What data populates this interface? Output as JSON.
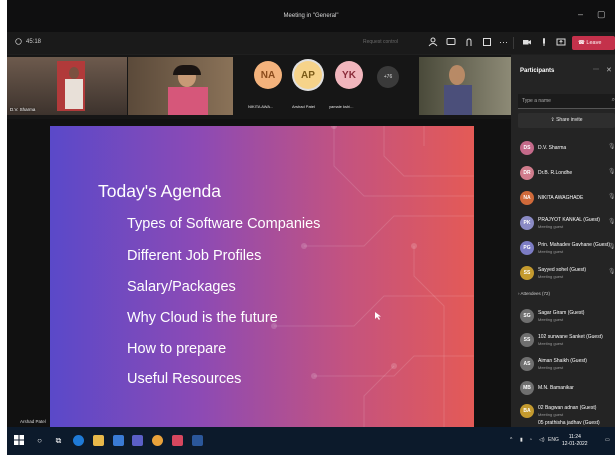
{
  "window": {
    "title": "Meeting in \"General\"",
    "minimize": "–",
    "maximize": "▢"
  },
  "toolbar": {
    "timer": "45:18",
    "request_control": "Request control",
    "leave_label": "Leave"
  },
  "videos": {
    "tile1_name": "D.V. Sharma",
    "avatars": [
      {
        "initials": "NA",
        "name": "NIKITA AWA...",
        "bg": "#f3b27c",
        "fg": "#8a4a1b"
      },
      {
        "initials": "AP",
        "name": "Arshad Patel",
        "bg": "#f6d38a",
        "fg": "#7a5a17"
      },
      {
        "initials": "YK",
        "name": "yamale kshi...",
        "bg": "#f1b6bd",
        "fg": "#8a2b3a"
      }
    ],
    "overflow": "+76"
  },
  "slide": {
    "title": "Today's Agenda",
    "items": [
      "Types of Software Companies",
      "Different Job Profiles",
      "Salary/Packages",
      "Why Cloud is the future",
      "How to prepare",
      "Useful Resources"
    ],
    "presenter": "Arshad Patel"
  },
  "participants": {
    "title": "Participants",
    "search_placeholder": "Type a name",
    "share_invite": "Share invite",
    "presenters": [
      {
        "initials": "DS",
        "name": "D.V. Sharma",
        "sub": "",
        "color": "#c46a8a"
      },
      {
        "initials": "DR",
        "name": "Dr.B. R.Londhe",
        "sub": "",
        "color": "#d07c8c"
      },
      {
        "initials": "NA",
        "name": "NIKITA AWAGHADE",
        "sub": "",
        "color": "#d06a3a"
      },
      {
        "initials": "PK",
        "name": "PRAJYOT KANKAL (Guest)",
        "sub": "Meeting guest",
        "color": "#8a8ac4"
      },
      {
        "initials": "PG",
        "name": "Prin. Mahadev Gavhane (Guest)",
        "sub": "Meeting guest",
        "color": "#7c7cc4"
      },
      {
        "initials": "SS",
        "name": "Sayyed sohel (Guest)",
        "sub": "Meeting guest",
        "color": "#c49a2e"
      }
    ],
    "attendees_header": "Attendees (72)",
    "attendees": [
      {
        "initials": "SG",
        "name": "Sagar Giram (Guest)",
        "sub": "Meeting guest",
        "color": "#6f6f6f"
      },
      {
        "initials": "SS",
        "name": "102 sunwane Sanket (Guest)",
        "sub": "Meeting guest",
        "color": "#6f6f6f"
      },
      {
        "initials": "AS",
        "name": "Aiman Shaikh (Guest)",
        "sub": "Meeting guest",
        "color": "#6f6f6f"
      },
      {
        "initials": "MB",
        "name": "M.N. Bamanikar",
        "sub": "",
        "color": "#6f6f6f"
      },
      {
        "initials": "BA",
        "name": "02 Bagwan adnan (Guest)",
        "sub": "Meeting guest",
        "color": "#c49a2e"
      },
      {
        "initials": "PJ",
        "name": "05 prathisha jadhav (Guest)",
        "sub": "",
        "color": "#6f6f6f"
      }
    ]
  },
  "taskbar": {
    "lang": "ENG",
    "time": "11:24",
    "date": "12-01-2022"
  }
}
